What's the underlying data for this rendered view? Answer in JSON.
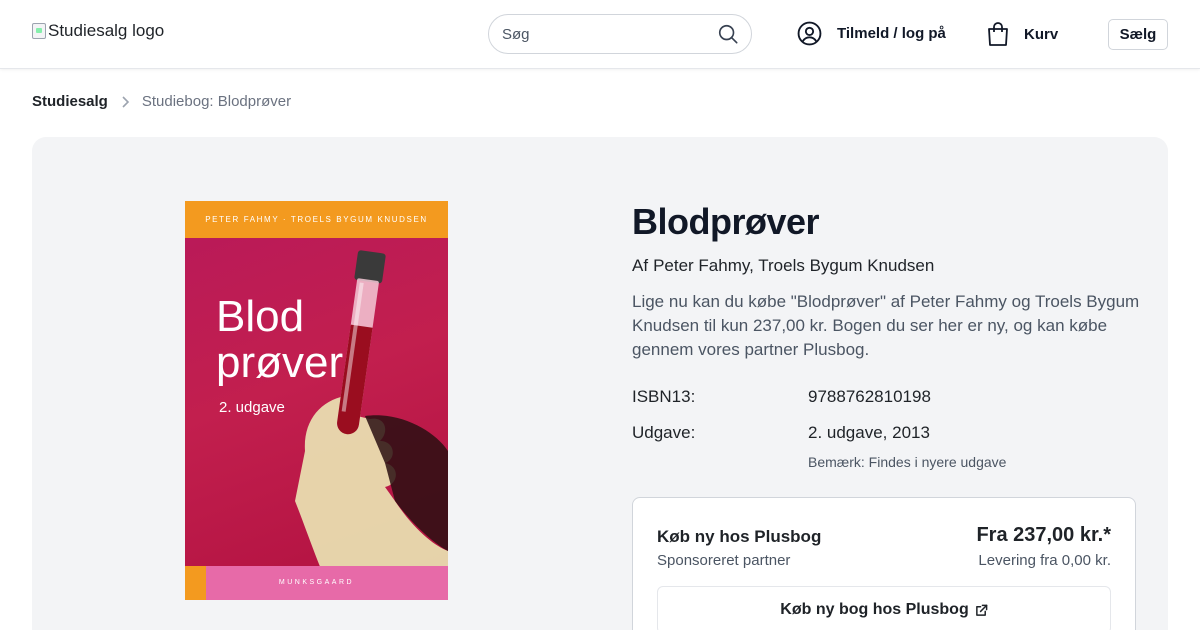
{
  "header": {
    "logo_alt": "Studiesalg logo",
    "search_placeholder": "Søg",
    "login_label": "Tilmeld / log på",
    "cart_label": "Kurv",
    "sell_label": "Sælg"
  },
  "breadcrumb": {
    "home": "Studiesalg",
    "current": "Studiebog: Blodprøver"
  },
  "cover": {
    "authors": "PETER FAHMY · TROELS BYGUM KNUDSEN",
    "title_line1": "Blod",
    "title_line2": "prøver",
    "edition": "2. udgave",
    "publisher": "MUNKSGAARD"
  },
  "book": {
    "title": "Blodprøver",
    "byline_prefix": "Af",
    "authors": "Peter Fahmy, Troels Bygum Knudsen",
    "description": "Lige nu kan du købe \"Blodprøver\" af Peter Fahmy og Troels Bygum Knudsen til kun 237,00 kr. Bogen du ser her er ny, og kan købe gennem vores partner Plusbog.",
    "specs": [
      {
        "label": "ISBN13:",
        "value": "9788762810198"
      },
      {
        "label": "Udgave:",
        "value": "2. udgave, 2013"
      }
    ],
    "edition_note": "Bemærk: Findes i nyere udgave"
  },
  "offer": {
    "seller": "Køb ny hos Plusbog",
    "sponsored": "Sponsoreret partner",
    "price": "Fra 237,00 kr.*",
    "delivery": "Levering fra 0,00 kr.",
    "buy_label": "Køb ny bog hos Plusbog"
  },
  "colors": {
    "panel_bg": "#f3f4f6",
    "cover_red": "#c21f4e",
    "cover_orange": "#f39a1f",
    "cover_pink": "#e76aa8"
  }
}
